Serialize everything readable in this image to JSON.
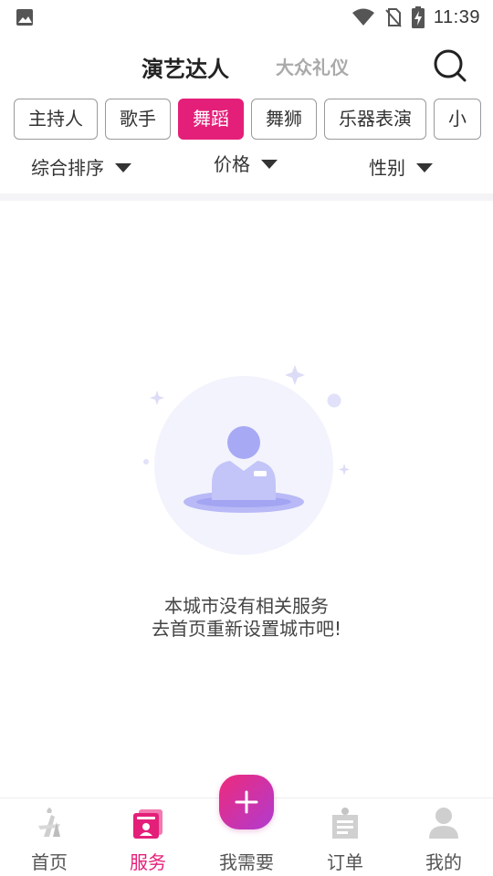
{
  "status_bar": {
    "time": "11:39"
  },
  "header": {
    "tab_primary": "演艺达人",
    "tab_secondary": "大众礼仪"
  },
  "categories": [
    {
      "label": "主持人"
    },
    {
      "label": "歌手"
    },
    {
      "label": "舞蹈",
      "active": true
    },
    {
      "label": "舞狮"
    },
    {
      "label": "乐器表演"
    },
    {
      "label": "小"
    }
  ],
  "filters": {
    "sort": "综合排序",
    "price": "价格",
    "gender": "性别"
  },
  "empty_state": {
    "line1": "本城市没有相关服务",
    "line2": "去首页重新设置城市吧!"
  },
  "bottom_nav": {
    "home": "首页",
    "service": "服务",
    "need": "我需要",
    "orders": "订单",
    "mine": "我的",
    "active": "service"
  },
  "colors": {
    "accent": "#e41f79",
    "fab_gradient_start": "#ee2a7b",
    "fab_gradient_end": "#b03bd0",
    "illustration": "#a8aaf5"
  }
}
